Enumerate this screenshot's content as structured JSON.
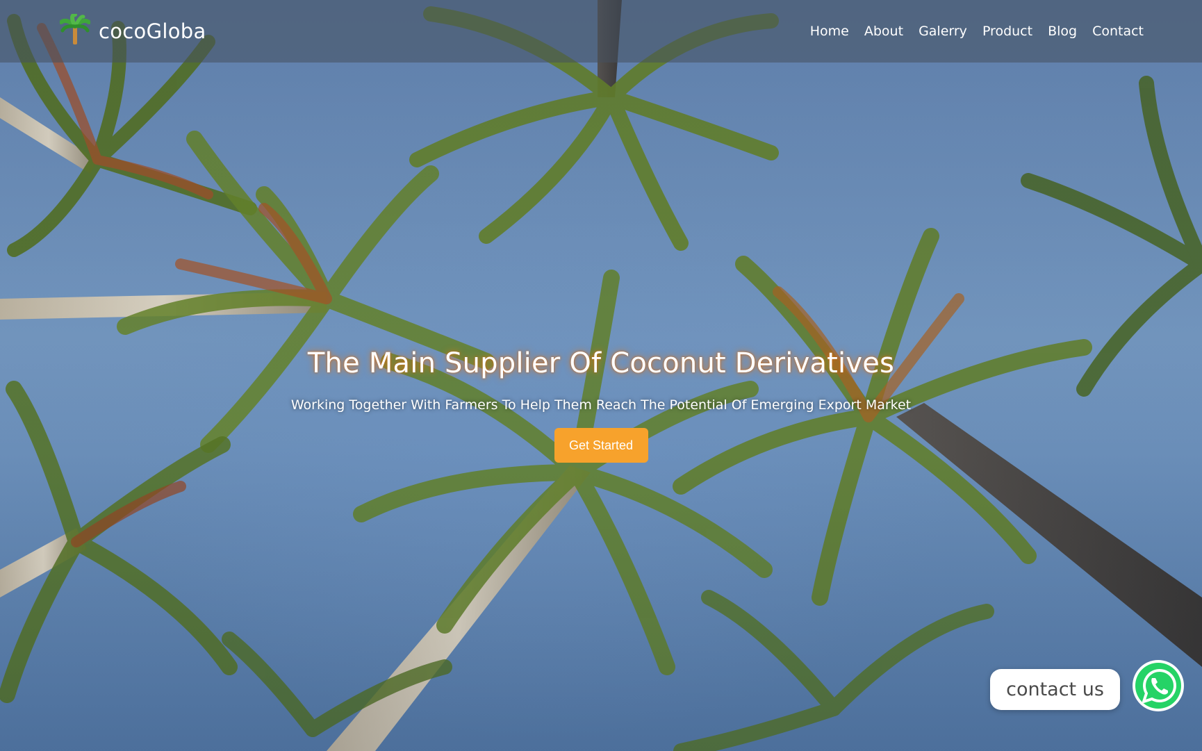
{
  "brand": {
    "name": "cocoGloba",
    "logo_icon": "palm-tree-icon"
  },
  "nav": {
    "items": [
      {
        "label": "Home"
      },
      {
        "label": "About"
      },
      {
        "label": "Galerry"
      },
      {
        "label": "Product"
      },
      {
        "label": "Blog"
      },
      {
        "label": "Contact"
      }
    ]
  },
  "hero": {
    "title": "The Main Supplier Of Coconut Derivatives",
    "subtitle": "Working Together With Farmers To Help Them Reach The Potential Of Emerging Export Market",
    "cta_label": "Get Started"
  },
  "floating": {
    "contact_label": "contact us",
    "whatsapp_icon": "whatsapp-icon"
  },
  "colors": {
    "accent": "#f7a22c",
    "header_bg": "rgba(70,80,95,0.55)",
    "whatsapp": "#25d366"
  }
}
